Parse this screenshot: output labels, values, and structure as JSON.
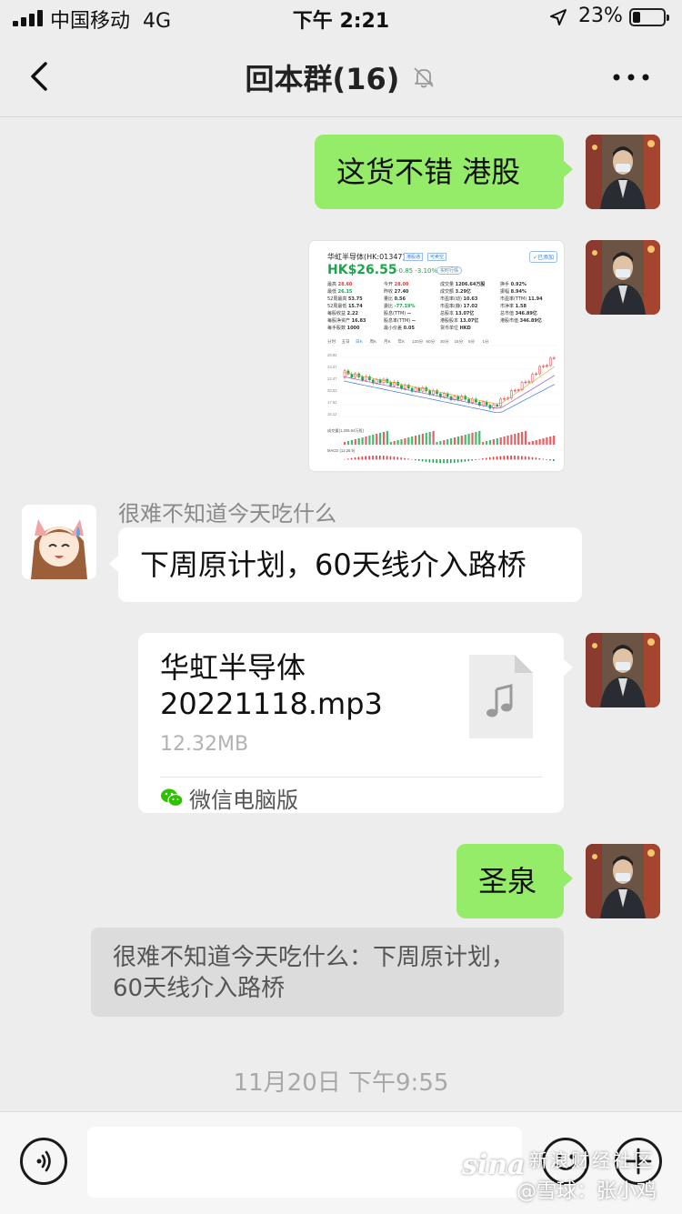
{
  "status_bar": {
    "carrier": "中国移动",
    "network": "4G",
    "time": "下午 2:21",
    "battery": "23%"
  },
  "nav": {
    "title": "回本群(16)"
  },
  "messages": [
    {
      "from": "me",
      "type": "text",
      "text": "这货不错  港股"
    },
    {
      "from": "me",
      "type": "image",
      "alt": "华虹半导体(HK:01347)"
    },
    {
      "from": "other",
      "sender": "很难不知道今天吃什么",
      "type": "text",
      "text": "下周原计划，60天线介入路桥"
    },
    {
      "from": "me",
      "type": "file",
      "file_name_line1": "华虹半导体",
      "file_name_line2": "20221118.mp3",
      "file_size": "12.32MB",
      "source": "微信电脑版"
    },
    {
      "from": "me",
      "type": "text",
      "text": "圣泉"
    }
  ],
  "quote": {
    "line1": "很难不知道今天吃什么：下周原计划，",
    "line2": "60天线介入路桥"
  },
  "timestamp": "11月20日 下午9:55",
  "input": {
    "value": ""
  },
  "watermark": {
    "brand": "sina",
    "line1": "新浪财经社区",
    "line2": "@雪球：张小鸡"
  },
  "stock": {
    "name": "华虹半导体(HK:01347)",
    "tag1": "港股通",
    "tag2": "可卖空",
    "added": "✓已添加",
    "price": "HK$26.55",
    "change": "-0.85 -3.10%",
    "subscribe": "实时行情",
    "rows": [
      [
        "最高",
        "28.60",
        "今开",
        "28.00",
        "成交量",
        "1206.64万股",
        "换手",
        "0.92%"
      ],
      [
        "最低",
        "26.15",
        "昨收",
        "27.40",
        "成交额",
        "3.29亿",
        "振幅",
        "8.94%"
      ],
      [
        "52周最高",
        "53.75",
        "量比",
        "0.56",
        "市盈率(动)",
        "10.63",
        "市盈率(TTM)",
        "11.94"
      ],
      [
        "52周最低",
        "15.74",
        "委比",
        "-77.19%",
        "市盈率(静)",
        "17.02",
        "市净率",
        "1.58"
      ],
      [
        "每股收益",
        "2.22",
        "股息(TTM)",
        "--",
        "总股本",
        "13.07亿",
        "总市值",
        "346.89亿"
      ],
      [
        "每股净资产",
        "16.83",
        "股息率(TTM)",
        "--",
        "港股股本",
        "13.07亿",
        "港股市值",
        "346.89亿"
      ],
      [
        "每手股数",
        "1000",
        "最小价差",
        "0.05",
        "货币单位",
        "HKD",
        "",
        ""
      ]
    ],
    "chart_tabs": [
      "分时",
      "五日",
      "日K",
      "周K",
      "月K",
      "年K",
      "120分",
      "60分",
      "30分",
      "15分",
      "5分",
      "1分"
    ],
    "y_ticks": [
      "29.82",
      "23.47",
      "22.47",
      "20.02",
      "17.52",
      "15.12"
    ],
    "volume_label": "成交量(1,206.64万股)",
    "macd_label": "MACD (12,26,9)"
  },
  "colors": {
    "green_bubble": "#95ec69",
    "background": "#ededed",
    "up": "#e0393e",
    "down": "#1aa64b"
  }
}
